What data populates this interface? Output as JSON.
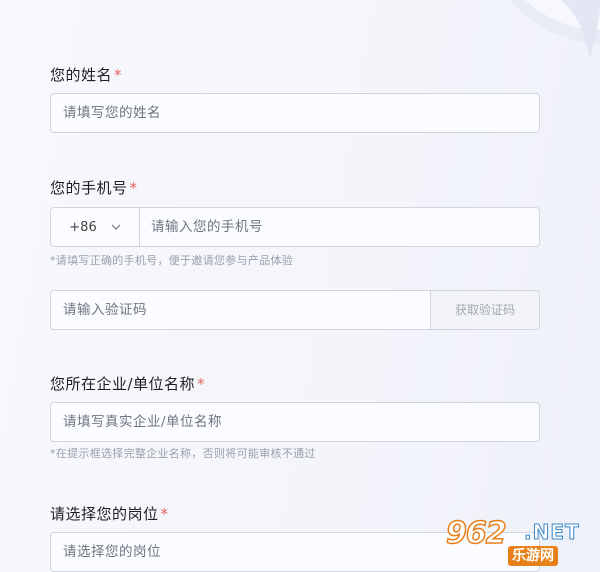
{
  "form": {
    "name": {
      "label": "您的姓名",
      "required_mark": "*",
      "placeholder": "请填写您的姓名"
    },
    "phone": {
      "label": "您的手机号",
      "required_mark": "*",
      "country_code": "+86",
      "placeholder": "请输入您的手机号",
      "hint": "*请填写正确的手机号，便于邀请您参与产品体验"
    },
    "verify": {
      "placeholder": "请输入验证码",
      "button_label": "获取验证码"
    },
    "company": {
      "label": "您所在企业/单位名称",
      "required_mark": "*",
      "placeholder": "请填写真实企业/单位名称",
      "hint": "*在提示框选择完整企业名称，否则将可能审核不通过"
    },
    "position": {
      "label": "请选择您的岗位",
      "required_mark": "*",
      "placeholder": "请选择您的岗位"
    }
  },
  "watermark": {
    "number": "962",
    "domain": ".NET",
    "site_name": "乐游网"
  },
  "colors": {
    "required": "#e8625f",
    "border": "#d2d5de",
    "hint": "#9aa0aa"
  },
  "icons": {
    "country_dropdown": "chevron-down-icon"
  }
}
